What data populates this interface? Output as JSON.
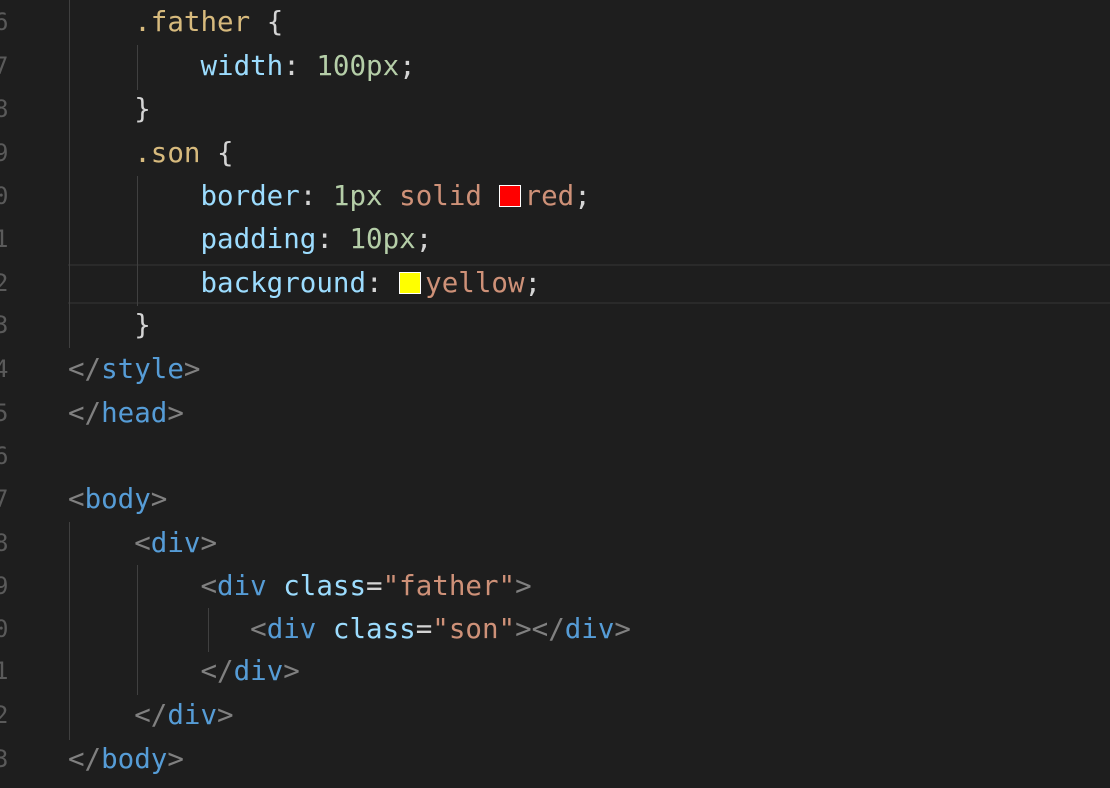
{
  "editor": {
    "lines": [
      {
        "num": "6",
        "tokens": [
          "    ",
          ".father",
          " {"
        ]
      },
      {
        "num": "7",
        "tokens": [
          "        ",
          "width",
          ": ",
          "100px",
          ";"
        ]
      },
      {
        "num": "8",
        "tokens": [
          "    ",
          "}"
        ]
      },
      {
        "num": "9",
        "tokens": [
          "    ",
          ".son",
          " {"
        ]
      },
      {
        "num": "0",
        "tokens": [
          "        ",
          "border",
          ": ",
          "1px",
          " ",
          "solid",
          " ",
          "red",
          ";"
        ]
      },
      {
        "num": "1",
        "tokens": [
          "        ",
          "padding",
          ": ",
          "10px",
          ";"
        ]
      },
      {
        "num": "2",
        "tokens": [
          "        ",
          "background",
          ": ",
          "yellow",
          ";"
        ]
      },
      {
        "num": "3",
        "tokens": [
          "    ",
          "}"
        ]
      },
      {
        "num": "4",
        "tokens": [
          "</",
          "style",
          ">"
        ]
      },
      {
        "num": "5",
        "tokens": [
          "</",
          "head",
          ">"
        ]
      },
      {
        "num": "6",
        "tokens": [
          ""
        ]
      },
      {
        "num": "7",
        "tokens": [
          "<",
          "body",
          ">"
        ]
      },
      {
        "num": "8",
        "tokens": [
          "    ",
          "<",
          "div",
          ">"
        ]
      },
      {
        "num": "9",
        "tokens": [
          "        ",
          "<",
          "div",
          " ",
          "class",
          "=",
          "\"father\"",
          ">"
        ]
      },
      {
        "num": "0",
        "tokens": [
          "           ",
          "<",
          "div",
          " ",
          "class",
          "=",
          "\"son\"",
          "></",
          "div",
          ">"
        ]
      },
      {
        "num": "1",
        "tokens": [
          "        ",
          "</",
          "div",
          ">"
        ]
      },
      {
        "num": "2",
        "tokens": [
          "    ",
          "</",
          "div",
          ">"
        ]
      },
      {
        "num": "3",
        "tokens": [
          "</",
          "body",
          ">"
        ]
      }
    ],
    "swatch_colors": {
      "red": "#ff0000",
      "yellow": "#ffff00"
    },
    "theme": {
      "background": "#1e1e1e",
      "selector": "#d7ba7d",
      "property": "#9cdcfe",
      "number": "#b5cea8",
      "value": "#ce9178",
      "tag": "#569cd6",
      "bracket": "#808080"
    }
  }
}
